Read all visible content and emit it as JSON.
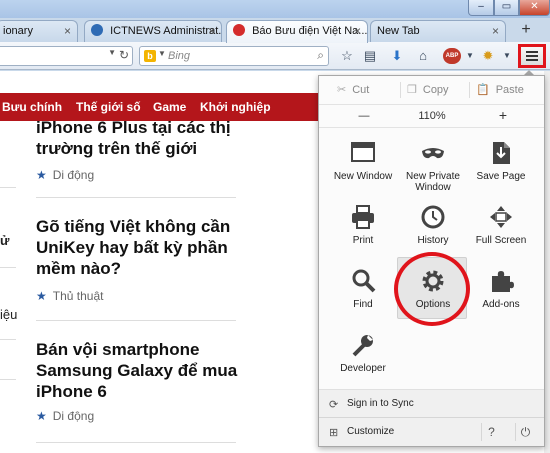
{
  "tabs": [
    {
      "label": "ionary"
    },
    {
      "label": "ICTNEWS Administrat..."
    },
    {
      "label": "Báo Bưu điện Việt Na..."
    },
    {
      "label": "New Tab"
    }
  ],
  "window": {
    "min": "–",
    "max": "▭",
    "close": "✕",
    "newtab": "+"
  },
  "search": {
    "placeholder": "Bing",
    "engine_icon": "b"
  },
  "site_nav": [
    "Bưu chính",
    "Thế giới số",
    "Game",
    "Khởi nghiệp"
  ],
  "articles": [
    {
      "title": "iPhone 6 Plus tại các thị trường trên thế giới",
      "category": "Di động"
    },
    {
      "title": "Gõ tiếng Việt không cần UniKey hay bất kỳ phần mềm nào?",
      "category": "Thủ thuật"
    },
    {
      "title": "Bán vội smartphone Samsung Galaxy để mua iPhone 6",
      "category": "Di động"
    }
  ],
  "left_fragments": [
    "ử",
    "iệu"
  ],
  "menu": {
    "edit": {
      "cut": "Cut",
      "copy": "Copy",
      "paste": "Paste"
    },
    "zoom": {
      "minus": "—",
      "level": "110%",
      "plus": "+"
    },
    "items": [
      {
        "label": "New Window",
        "icon": "new-window-icon"
      },
      {
        "label": "New Private\nWindow",
        "icon": "private-mask-icon"
      },
      {
        "label": "Save Page",
        "icon": "save-page-icon"
      },
      {
        "label": "Print",
        "icon": "printer-icon"
      },
      {
        "label": "History",
        "icon": "clock-icon"
      },
      {
        "label": "Full Screen",
        "icon": "fullscreen-icon"
      },
      {
        "label": "Find",
        "icon": "magnifier-icon"
      },
      {
        "label": "Options",
        "icon": "gear-icon"
      },
      {
        "label": "Add-ons",
        "icon": "puzzle-icon"
      },
      {
        "label": "Developer",
        "icon": "wrench-icon"
      }
    ],
    "sync": "Sign in to Sync",
    "customize": "Customize"
  },
  "colors": {
    "site_red": "#b4161b",
    "highlight_red": "#e0141b"
  }
}
